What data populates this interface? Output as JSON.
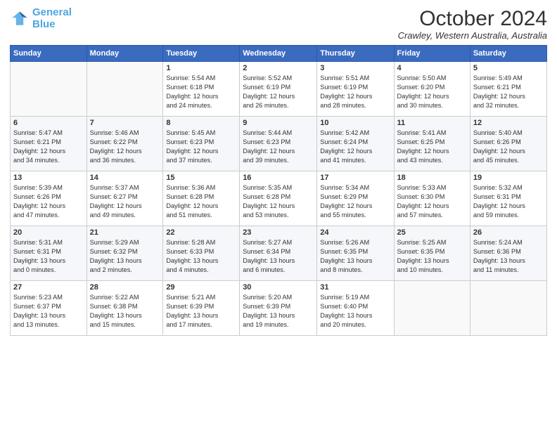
{
  "header": {
    "logo_line1": "General",
    "logo_line2": "Blue",
    "month_title": "October 2024",
    "location": "Crawley, Western Australia, Australia"
  },
  "days_of_week": [
    "Sunday",
    "Monday",
    "Tuesday",
    "Wednesday",
    "Thursday",
    "Friday",
    "Saturday"
  ],
  "weeks": [
    [
      {
        "day": "",
        "info": ""
      },
      {
        "day": "",
        "info": ""
      },
      {
        "day": "1",
        "info": "Sunrise: 5:54 AM\nSunset: 6:18 PM\nDaylight: 12 hours\nand 24 minutes."
      },
      {
        "day": "2",
        "info": "Sunrise: 5:52 AM\nSunset: 6:19 PM\nDaylight: 12 hours\nand 26 minutes."
      },
      {
        "day": "3",
        "info": "Sunrise: 5:51 AM\nSunset: 6:19 PM\nDaylight: 12 hours\nand 28 minutes."
      },
      {
        "day": "4",
        "info": "Sunrise: 5:50 AM\nSunset: 6:20 PM\nDaylight: 12 hours\nand 30 minutes."
      },
      {
        "day": "5",
        "info": "Sunrise: 5:49 AM\nSunset: 6:21 PM\nDaylight: 12 hours\nand 32 minutes."
      }
    ],
    [
      {
        "day": "6",
        "info": "Sunrise: 5:47 AM\nSunset: 6:21 PM\nDaylight: 12 hours\nand 34 minutes."
      },
      {
        "day": "7",
        "info": "Sunrise: 5:46 AM\nSunset: 6:22 PM\nDaylight: 12 hours\nand 36 minutes."
      },
      {
        "day": "8",
        "info": "Sunrise: 5:45 AM\nSunset: 6:23 PM\nDaylight: 12 hours\nand 37 minutes."
      },
      {
        "day": "9",
        "info": "Sunrise: 5:44 AM\nSunset: 6:23 PM\nDaylight: 12 hours\nand 39 minutes."
      },
      {
        "day": "10",
        "info": "Sunrise: 5:42 AM\nSunset: 6:24 PM\nDaylight: 12 hours\nand 41 minutes."
      },
      {
        "day": "11",
        "info": "Sunrise: 5:41 AM\nSunset: 6:25 PM\nDaylight: 12 hours\nand 43 minutes."
      },
      {
        "day": "12",
        "info": "Sunrise: 5:40 AM\nSunset: 6:26 PM\nDaylight: 12 hours\nand 45 minutes."
      }
    ],
    [
      {
        "day": "13",
        "info": "Sunrise: 5:39 AM\nSunset: 6:26 PM\nDaylight: 12 hours\nand 47 minutes."
      },
      {
        "day": "14",
        "info": "Sunrise: 5:37 AM\nSunset: 6:27 PM\nDaylight: 12 hours\nand 49 minutes."
      },
      {
        "day": "15",
        "info": "Sunrise: 5:36 AM\nSunset: 6:28 PM\nDaylight: 12 hours\nand 51 minutes."
      },
      {
        "day": "16",
        "info": "Sunrise: 5:35 AM\nSunset: 6:28 PM\nDaylight: 12 hours\nand 53 minutes."
      },
      {
        "day": "17",
        "info": "Sunrise: 5:34 AM\nSunset: 6:29 PM\nDaylight: 12 hours\nand 55 minutes."
      },
      {
        "day": "18",
        "info": "Sunrise: 5:33 AM\nSunset: 6:30 PM\nDaylight: 12 hours\nand 57 minutes."
      },
      {
        "day": "19",
        "info": "Sunrise: 5:32 AM\nSunset: 6:31 PM\nDaylight: 12 hours\nand 59 minutes."
      }
    ],
    [
      {
        "day": "20",
        "info": "Sunrise: 5:31 AM\nSunset: 6:31 PM\nDaylight: 13 hours\nand 0 minutes."
      },
      {
        "day": "21",
        "info": "Sunrise: 5:29 AM\nSunset: 6:32 PM\nDaylight: 13 hours\nand 2 minutes."
      },
      {
        "day": "22",
        "info": "Sunrise: 5:28 AM\nSunset: 6:33 PM\nDaylight: 13 hours\nand 4 minutes."
      },
      {
        "day": "23",
        "info": "Sunrise: 5:27 AM\nSunset: 6:34 PM\nDaylight: 13 hours\nand 6 minutes."
      },
      {
        "day": "24",
        "info": "Sunrise: 5:26 AM\nSunset: 6:35 PM\nDaylight: 13 hours\nand 8 minutes."
      },
      {
        "day": "25",
        "info": "Sunrise: 5:25 AM\nSunset: 6:35 PM\nDaylight: 13 hours\nand 10 minutes."
      },
      {
        "day": "26",
        "info": "Sunrise: 5:24 AM\nSunset: 6:36 PM\nDaylight: 13 hours\nand 11 minutes."
      }
    ],
    [
      {
        "day": "27",
        "info": "Sunrise: 5:23 AM\nSunset: 6:37 PM\nDaylight: 13 hours\nand 13 minutes."
      },
      {
        "day": "28",
        "info": "Sunrise: 5:22 AM\nSunset: 6:38 PM\nDaylight: 13 hours\nand 15 minutes."
      },
      {
        "day": "29",
        "info": "Sunrise: 5:21 AM\nSunset: 6:39 PM\nDaylight: 13 hours\nand 17 minutes."
      },
      {
        "day": "30",
        "info": "Sunrise: 5:20 AM\nSunset: 6:39 PM\nDaylight: 13 hours\nand 19 minutes."
      },
      {
        "day": "31",
        "info": "Sunrise: 5:19 AM\nSunset: 6:40 PM\nDaylight: 13 hours\nand 20 minutes."
      },
      {
        "day": "",
        "info": ""
      },
      {
        "day": "",
        "info": ""
      }
    ]
  ]
}
